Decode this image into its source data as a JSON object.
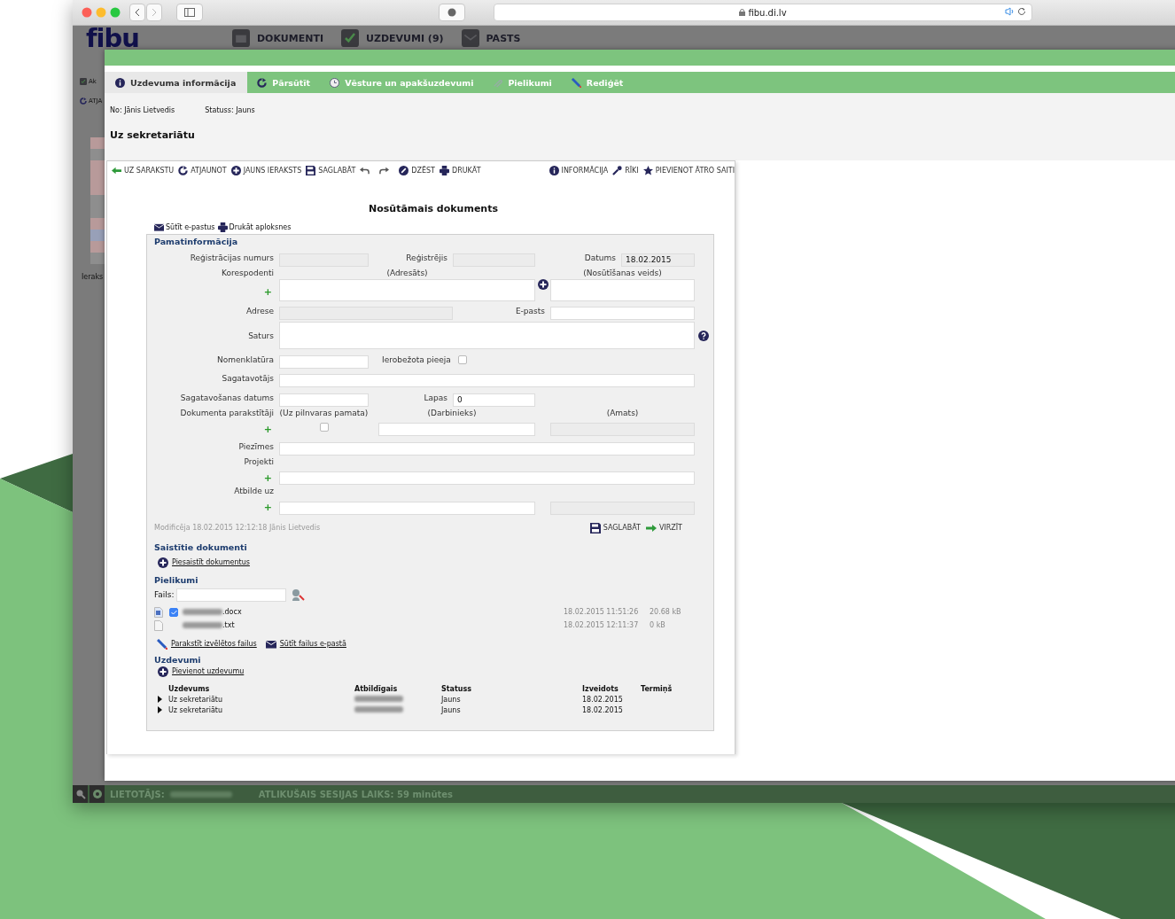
{
  "browser": {
    "url": "fibu.di.lv"
  },
  "app_header": {
    "logo": "fibu",
    "nav": [
      {
        "label": "DOKUMENTI",
        "kind": "folder"
      },
      {
        "label": "UZDEVUMI (9)",
        "kind": "tasks"
      },
      {
        "label": "PASTS",
        "kind": "mail"
      }
    ]
  },
  "background_list": {
    "toolbar": [
      {
        "label": "Ak",
        "kind": "tasks"
      },
      {
        "label": "ATJA",
        "kind": "refresh"
      }
    ],
    "footer": "Ieraks"
  },
  "modal": {
    "tabs": [
      {
        "label": "Uzdevuma informācija",
        "kind": "info",
        "selected": true
      },
      {
        "label": "Pārsūtīt",
        "kind": "refresh",
        "selected": false
      },
      {
        "label": "Vēsture un apakšuzdevumi",
        "kind": "clock",
        "selected": false
      },
      {
        "label": "Pielikumi",
        "kind": "clip",
        "selected": false
      },
      {
        "label": "Rediģēt",
        "kind": "pen",
        "selected": false
      }
    ],
    "info": {
      "from_label": "No:",
      "from": "Jānis Lietvedis",
      "status_label": "Statuss:",
      "status": "Jauns",
      "title": "Uz sekretariātu"
    }
  },
  "toolbar": [
    {
      "label": "UZ SARAKSTU",
      "kind": "back"
    },
    {
      "label": "ATJAUNOT",
      "kind": "refresh"
    },
    {
      "label": "JAUNS IERAKSTS",
      "kind": "add"
    },
    {
      "label": "SAGLABĀT",
      "kind": "save"
    },
    {
      "kind": "undo"
    },
    {
      "kind": "redo"
    },
    {
      "label": "DZĒST",
      "kind": "delete"
    },
    {
      "label": "DRUKĀT",
      "kind": "print"
    },
    {
      "label": "INFORMĀCIJA",
      "kind": "info"
    },
    {
      "label": "RĪKI",
      "kind": "tools"
    },
    {
      "label": "PIEVIENOT ĀTRO SAITI",
      "kind": "star"
    }
  ],
  "document": {
    "title": "Nosūtāmais dokuments",
    "actions": [
      {
        "label": "Sūtīt e-pastus",
        "kind": "mail"
      },
      {
        "label": "Drukāt aploksnes",
        "kind": "print"
      }
    ],
    "form": {
      "heading": "Pamatinformācija",
      "lines": [
        {
          "cells": [
            {
              "kind": "label",
              "text": "Reģistrācijas numurs"
            },
            {
              "kind": "field",
              "disabled": true
            },
            {
              "kind": "label",
              "text": "Reģistrējis"
            },
            {
              "kind": "field",
              "disabled": true
            },
            {
              "kind": "label",
              "text": "Datums"
            },
            {
              "kind": "field",
              "disabled": true,
              "value": "18.02.2015"
            }
          ]
        },
        {
          "cells": [
            {
              "kind": "label",
              "text": "Korespodenti"
            },
            {
              "kind": "note",
              "text": "(Adresāts)"
            },
            {
              "kind": "note",
              "text": "(Nosūtīšanas veids)"
            }
          ]
        },
        {
          "cells": [
            {
              "kind": "plus",
              "text": "+"
            },
            {
              "kind": "field",
              "disabled": false
            },
            {
              "kind": "add_icon"
            },
            {
              "kind": "field",
              "disabled": false
            }
          ]
        },
        {
          "cells": [
            {
              "kind": "label",
              "text": "Adrese"
            },
            {
              "kind": "field",
              "disabled": true
            },
            {
              "kind": "label",
              "text": "E-pasts"
            },
            {
              "kind": "field",
              "disabled": false
            }
          ]
        },
        {
          "cells": [
            {
              "kind": "label",
              "text": "Saturs"
            },
            {
              "kind": "field",
              "disabled": false
            },
            {
              "kind": "help"
            }
          ]
        },
        {
          "cells": [
            {
              "kind": "label",
              "text": "Nomenklatūra"
            },
            {
              "kind": "field",
              "disabled": false
            },
            {
              "kind": "check_label",
              "text": "Ierobežota pieeja",
              "checked": false
            }
          ]
        },
        {
          "cells": [
            {
              "kind": "label",
              "text": "Sagatavotājs"
            },
            {
              "kind": "field",
              "disabled": false
            }
          ]
        },
        {
          "cells": [
            {
              "kind": "label",
              "text": "Sagatavošanas datums"
            },
            {
              "kind": "field",
              "disabled": false
            },
            {
              "kind": "label",
              "text": "Lapas"
            },
            {
              "kind": "field",
              "disabled": false,
              "value": "0"
            }
          ]
        },
        {
          "cells": [
            {
              "kind": "label",
              "text": "Dokumenta parakstītāji"
            },
            {
              "kind": "note",
              "text": "(Uz pilnvaras pamata)"
            },
            {
              "kind": "note",
              "text": "(Darbinieks)"
            },
            {
              "kind": "note",
              "text": "(Amats)"
            }
          ]
        },
        {
          "cells": [
            {
              "kind": "plus",
              "text": "+"
            },
            {
              "kind": "checkbox",
              "checked": false
            },
            {
              "kind": "field",
              "disabled": false
            },
            {
              "kind": "field",
              "disabled": true
            }
          ]
        },
        {
          "cells": [
            {
              "kind": "label",
              "text": "Piezīmes"
            },
            {
              "kind": "field",
              "disabled": false
            }
          ]
        },
        {
          "cells": [
            {
              "kind": "label",
              "text": "Projekti"
            }
          ]
        },
        {
          "cells": [
            {
              "kind": "plus",
              "text": "+"
            },
            {
              "kind": "field",
              "disabled": false
            }
          ]
        },
        {
          "cells": [
            {
              "kind": "label",
              "text": "Atbilde uz"
            }
          ]
        },
        {
          "cells": [
            {
              "kind": "plus",
              "text": "+"
            },
            {
              "kind": "field",
              "disabled": false
            },
            {
              "kind": "field",
              "disabled": true
            }
          ]
        }
      ]
    },
    "modified": "Modificēja 18.02.2015 12:12:18 Jānis Lietvedis",
    "form_actions": [
      {
        "label": "SAGLABĀT",
        "kind": "save"
      },
      {
        "label": "VIRZĪT",
        "kind": "forward"
      }
    ],
    "linked": {
      "heading": "Saistītie dokumenti",
      "link": "Piesaistīt dokumentus"
    },
    "attachments": {
      "heading": "Pielikumi",
      "file_label": "Fails:",
      "files": [
        {
          "name": ".docx",
          "kind": "word",
          "checked": true,
          "date": "18.02.2015 11:51:26",
          "size": "20.68 kB"
        },
        {
          "name": ".txt",
          "kind": "text",
          "date": "18.02.2015 12:11:37",
          "size": "0 kB"
        }
      ],
      "actions": [
        {
          "label": "Parakstīt izvēlētos failus",
          "kind": "sign"
        },
        {
          "label": "Sūtīt failus e-pastā",
          "kind": "mail"
        }
      ]
    },
    "tasks": {
      "heading": "Uzdevumi",
      "link": "Pievienot uzdevumu",
      "columns": [
        "Uzdevums",
        "Atbildīgais",
        "Statuss",
        "Izveidots",
        "Termiņš"
      ],
      "rows": [
        {
          "task": "Uz sekretariātu",
          "status": "Jauns",
          "created": "18.02.2015",
          "expanded": false
        },
        {
          "task": "Uz sekretariātu",
          "status": "Jauns",
          "created": "18.02.2015",
          "expanded": false
        }
      ]
    }
  },
  "status_bar": {
    "user_label": "LIETOTĀJS:",
    "session": "ATLIKUŠAIS SESIJAS LAIKS: 59 minūtes"
  }
}
